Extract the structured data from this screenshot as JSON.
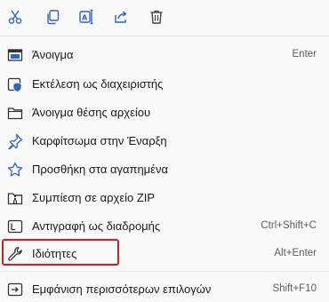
{
  "quick_actions": [
    {
      "name": "cut",
      "icon": "scissors-icon"
    },
    {
      "name": "copy",
      "icon": "copy-icon"
    },
    {
      "name": "rename",
      "icon": "rename-icon"
    },
    {
      "name": "share",
      "icon": "share-icon"
    },
    {
      "name": "delete",
      "icon": "trash-icon"
    }
  ],
  "items": [
    {
      "label": "Άνοιγμα",
      "shortcut": "Enter",
      "icon": "open-window-icon"
    },
    {
      "label": "Εκτέλεση ως διαχειριστής",
      "shortcut": "",
      "icon": "admin-shield-icon"
    },
    {
      "label": "Άνοιγμα θέσης αρχείου",
      "shortcut": "",
      "icon": "folder-icon"
    },
    {
      "label": "Καρφίτσωμα στην Έναρξη",
      "shortcut": "",
      "icon": "pin-icon"
    },
    {
      "label": "Προσθήκη στα αγαπημένα",
      "shortcut": "",
      "icon": "star-icon"
    },
    {
      "label": "Συμπίεση σε αρχείο ZIP",
      "shortcut": "",
      "icon": "zip-folder-icon"
    },
    {
      "label": "Αντιγραφή ως διαδρομής",
      "shortcut": "Ctrl+Shift+C",
      "icon": "copy-path-icon"
    },
    {
      "label": "Ιδιότητες",
      "shortcut": "Alt+Enter",
      "icon": "wrench-icon"
    },
    {
      "label": "Εμφάνιση περισσότερων επιλογών",
      "shortcut": "Shift+F10",
      "icon": "more-options-icon"
    }
  ],
  "colors": {
    "accent": "#2b66c4",
    "highlight_border": "#e0181f"
  }
}
